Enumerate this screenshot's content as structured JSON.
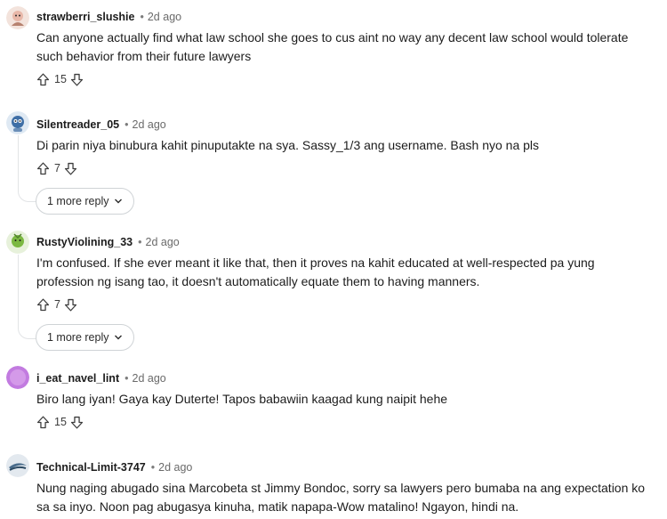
{
  "comments": [
    {
      "author": "strawberri_slushie",
      "time": "2d ago",
      "text": "Can anyone actually find what law school she goes to cus aint no way any decent law school would tolerate such behavior from their future lawyers",
      "votes": "15",
      "avatar_color": "#e8b7a8"
    },
    {
      "author": "Silentreader_05",
      "time": "2d ago",
      "text": "Di parin niya binubura kahit pinuputakte na sya. Sassy_1/3 ang username. Bash nyo na pls",
      "votes": "7",
      "more_replies": "1 more reply",
      "avatar_color": "#3f6fa6"
    },
    {
      "author": "RustyViolining_33",
      "time": "2d ago",
      "text": "I'm confused. If she ever meant it like that, then it proves na kahit educated at well-respected pa yung profession ng isang tao,  it doesn't automatically equate them to having manners.",
      "votes": "7",
      "more_replies": "1 more reply",
      "avatar_color": "#7bb842"
    },
    {
      "author": "i_eat_navel_lint",
      "time": "2d ago",
      "text": "Biro lang iyan! Gaya kay Duterte! Tapos babawiin kaagad kung naipit hehe",
      "votes": "15",
      "avatar_color": "#c27be0"
    },
    {
      "author": "Technical-Limit-3747",
      "time": "2d ago",
      "text": "Nung naging abugado sina Marcobeta st Jimmy Bondoc, sorry sa lawyers pero bumaba na ang expectation ko sa sa inyo. Noon pag abugasya kinuha, matik napapa-Wow matalino! Ngayon, hindi na.",
      "votes": "",
      "avatar_color": "#4a6d8c"
    }
  ],
  "separator": "•"
}
